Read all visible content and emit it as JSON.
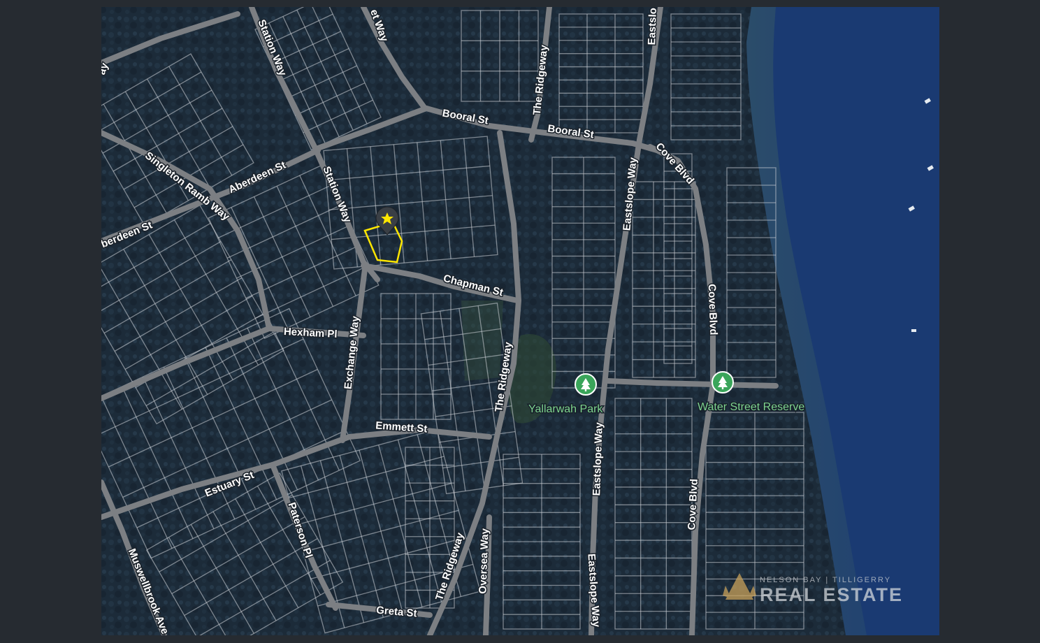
{
  "map": {
    "streets": [
      {
        "name": "Station Way"
      },
      {
        "name": "Station Way"
      },
      {
        "name": "Booral St"
      },
      {
        "name": "Booral St"
      },
      {
        "name": "The Ridgeway"
      },
      {
        "name": "The Ridgeway"
      },
      {
        "name": "The Ridgeway"
      },
      {
        "name": "Eastslope Way"
      },
      {
        "name": "Eastslope Way"
      },
      {
        "name": "Eastslope Way"
      },
      {
        "name": "Cove Blvd"
      },
      {
        "name": "Cove Blvd"
      },
      {
        "name": "Cove Blvd"
      },
      {
        "name": "Aberdeen St"
      },
      {
        "name": "Singleton Ramb Way"
      },
      {
        "name": "Chapman St"
      },
      {
        "name": "Hexham Pl"
      },
      {
        "name": "Exchange Way"
      },
      {
        "name": "Emmett St"
      },
      {
        "name": "Estuary St"
      },
      {
        "name": "Paterson Pl"
      },
      {
        "name": "Muswellbrook Ave"
      },
      {
        "name": "Oversea Way"
      },
      {
        "name": "Greta St"
      }
    ],
    "partial_labels": {
      "top_way": "et Way",
      "left_way": "ay",
      "left_aberdeen": "berdeen St",
      "eastslope_top": "Eastslo"
    },
    "pois": [
      {
        "name": "Yallarwah Park",
        "icon": "tree-pin-icon"
      },
      {
        "name": "Water Street Reserve",
        "icon": "tree-pin-icon"
      }
    ],
    "property_marker": {
      "icon": "star-pin-icon",
      "outline_color": "#ffe600"
    },
    "colors": {
      "water": "#1a3a72",
      "land": "#1c2a38",
      "road": "#7c7f83",
      "poi": "#7ed38f"
    }
  },
  "watermark": {
    "line1": "NELSON BAY | TILLIGERRY",
    "line2": "REAL ESTATE"
  }
}
